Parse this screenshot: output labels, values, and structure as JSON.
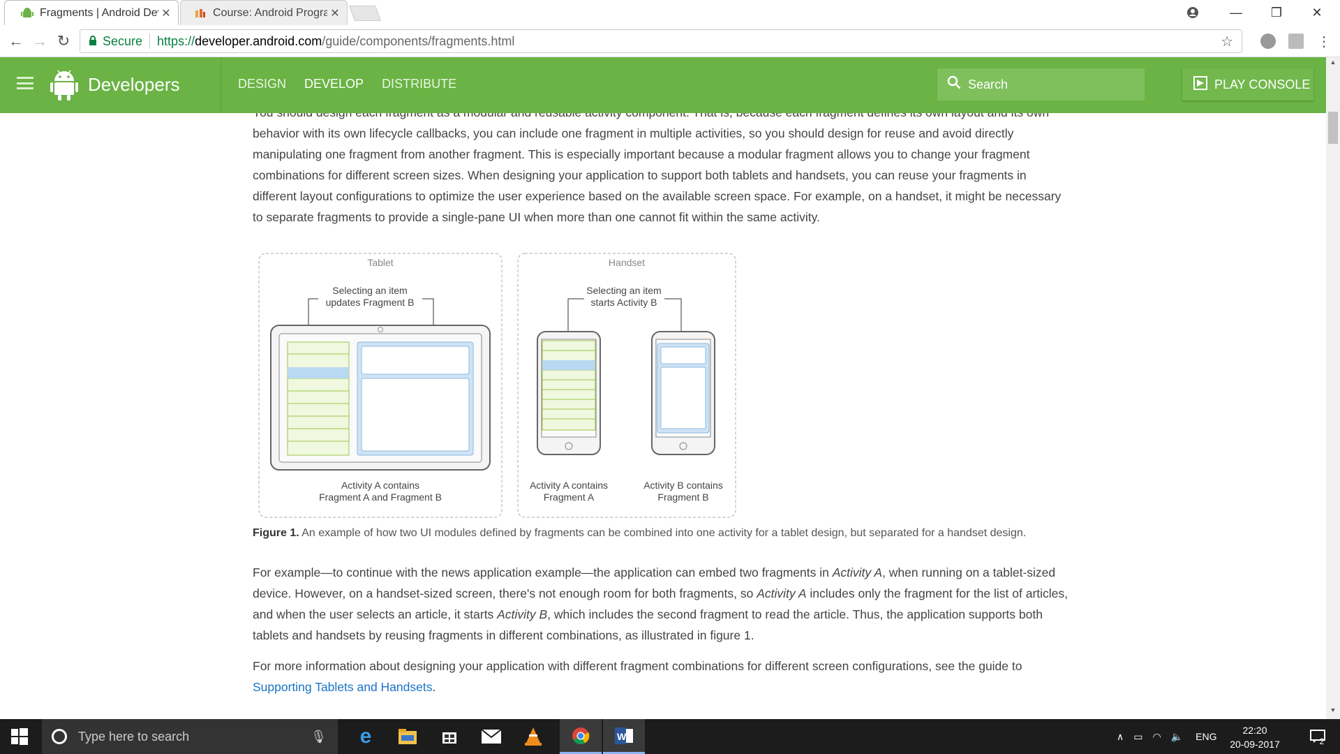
{
  "browser": {
    "tabs": [
      {
        "title": "Fragments | Android Dev",
        "active": true
      },
      {
        "title": "Course: Android Progran",
        "active": false
      }
    ],
    "security_label": "Secure",
    "url_scheme": "https://",
    "url_host": "developer.android.com",
    "url_path": "/guide/components/fragments.html"
  },
  "site": {
    "brand": "Developers",
    "nav": [
      "DESIGN",
      "DEVELOP",
      "DISTRIBUTE"
    ],
    "active_nav": "DEVELOP",
    "search_placeholder": "Search",
    "play_console": "PLAY CONSOLE",
    "header_color": "#6ab344"
  },
  "article": {
    "intro_cutoff": "You should design each fragment as a modular and reusable activity component. That is, because each fragment defines its own layout and its own",
    "intro_lines": [
      "behavior with its own lifecycle callbacks, you can include one fragment in multiple activities, so you should design for reuse and avoid directly",
      "manipulating one fragment from another fragment. This is especially important because a modular fragment allows you to change your fragment",
      "combinations for different screen sizes. When designing your application to support both tablets and handsets, you can reuse your fragments in",
      "different layout configurations to optimize the user experience based on the available screen space. For example, on a handset, it might be necessary",
      "to separate fragments to provide a single-pane UI when more than one cannot fit within the same activity."
    ],
    "figure": {
      "tablet_label": "Tablet",
      "handset_label": "Handset",
      "tablet_note_1": "Selecting an item",
      "tablet_note_2": "updates Fragment B",
      "handset_note_1": "Selecting an item",
      "handset_note_2": "starts Activity B",
      "tablet_caption_1": "Activity A contains",
      "tablet_caption_2": "Fragment A and Fragment B",
      "handset_a_caption_1": "Activity A contains",
      "handset_a_caption_2": "Fragment A",
      "handset_b_caption_1": "Activity B contains",
      "handset_b_caption_2": "Fragment B"
    },
    "caption_label": "Figure 1.",
    "caption_text": " An example of how two UI modules defined by fragments can be combined into one activity for a tablet design, but separated for a handset design.",
    "para2": {
      "l1a": "For example—to continue with the news application example—the application can embed two fragments in ",
      "l1b": "Activity A",
      "l1c": ", when running on a tablet-sized",
      "l2a": "device. However, on a handset-sized screen, there's not enough room for both fragments, so ",
      "l2b": "Activity A",
      "l2c": " includes only the fragment for the list of articles,",
      "l3a": "and when the user selects an article, it starts ",
      "l3b": "Activity B",
      "l3c": ", which includes the second fragment to read the article. Thus, the application supports both",
      "l4": "tablets and handsets by reusing fragments in different combinations, as illustrated in figure 1."
    },
    "para3_line1": "For more information about designing your application with different fragment combinations for different screen configurations, see the guide to",
    "para3_link": "Supporting Tablets and Handsets",
    "para3_end": "."
  },
  "taskbar": {
    "search_placeholder": "Type here to search",
    "language": "ENG",
    "time": "22:20",
    "date": "20-09-2017",
    "notifications": "2"
  }
}
